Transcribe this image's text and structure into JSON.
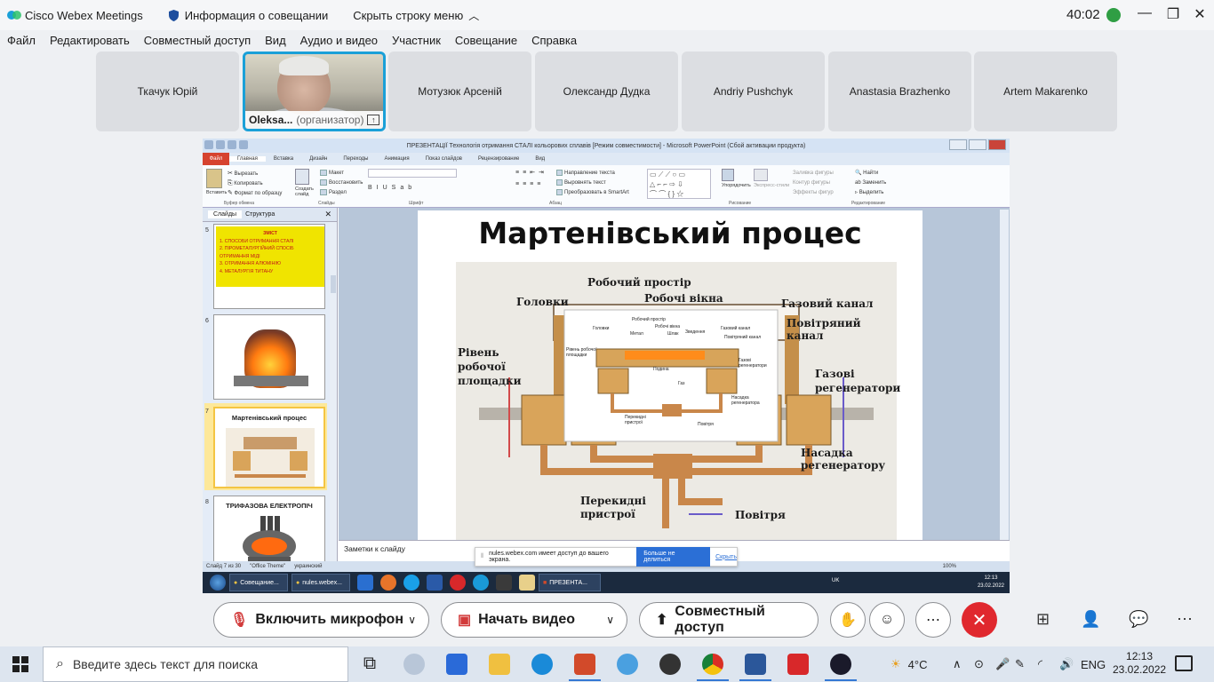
{
  "titlebar": {
    "app_name": "Cisco Webex Meetings",
    "meeting_info": "Информация о совещании",
    "hide_menu": "Скрыть строку меню",
    "elapsed": "40:02"
  },
  "menu": [
    "Файл",
    "Редактировать",
    "Совместный доступ",
    "Вид",
    "Аудио и видео",
    "Участник",
    "Совещание",
    "Справка"
  ],
  "participants": [
    {
      "name": "Ткачук Юрій"
    },
    {
      "name": "Oleksa...",
      "role": "(организатор)",
      "video": true
    },
    {
      "name": "Мотузюк Арсеній"
    },
    {
      "name": "Олександр Дудка"
    },
    {
      "name": "Andriy Pushchyk"
    },
    {
      "name": "Anastasia Brazhenko"
    },
    {
      "name": "Artem Makarenko"
    }
  ],
  "shared": {
    "window_title": "ПРЕЗЕНТАЦІЇ Технологія отримання СТАЛІ кольорових сплавів [Режим совместимости] - Microsoft PowerPoint (Сбой активации продукта)",
    "ribbon_tabs": [
      "Файл",
      "Главная",
      "Вставка",
      "Дизайн",
      "Переходы",
      "Анимация",
      "Показ слайдов",
      "Рецензирование",
      "Вид"
    ],
    "ribbon": {
      "cut": "Вырезать",
      "copy": "Копировать",
      "format_painter": "Формат по образцу",
      "paste": "Вставить",
      "new_slide": "Создать слайд",
      "layout": "Макет",
      "reset": "Восстановить",
      "section": "Раздел",
      "text_direction": "Направление текста",
      "align_text": "Выровнять текст",
      "smartart": "Преобразовать в SmartArt",
      "arrange": "Упорядочить",
      "quick_styles": "Экспресс-стили",
      "shape_fill": "Заливка фигуры",
      "shape_outline": "Контур фигуры",
      "shape_effects": "Эффекты фигур",
      "find": "Найти",
      "replace": "Заменить",
      "select": "Выделить"
    },
    "group_labels": [
      "Буфер обмена",
      "Слайды",
      "Шрифт",
      "Абзац",
      "Рисование",
      "Редактирование"
    ],
    "left_tabs": [
      "Слайды",
      "Структура"
    ],
    "thumbnails": [
      {
        "num": "5",
        "title": "ЗМІСТ",
        "lines": [
          "1. СПОСОБИ ОТРИМАННЯ СТАЛІ",
          "2. ПІРОМЕТАЛУРГІЙНИЙ СПОСІБ ОТРИМАННЯ МІДІ",
          "3. ОТРИМАННЯ АЛЮМІНІЮ",
          "4. МЕТАЛУРГІЯ ТИТАНУ"
        ]
      },
      {
        "num": "6"
      },
      {
        "num": "7",
        "title": "Мартенівський процес"
      },
      {
        "num": "8",
        "title": "ТРИФАЗОВА ЕЛЕКТРОПІЧ"
      }
    ],
    "slide": {
      "title": "Мартенівський процес",
      "labels": {
        "working_space": "Робочий простір",
        "working_windows": "Робочі вікна",
        "heads": "Головки",
        "gas_channel": "Газовий канал",
        "air_channel": "Повітряний канал",
        "platform_level": "Рівень робочої площадки",
        "gas_regenerators": "Газові регенератори",
        "regenerator_packing": "Насадка регенератору",
        "switching_devices": "Перекидні пристрої",
        "air": "Повітря"
      },
      "inset_labels": {
        "working_space": "Робочий простір",
        "heads": "Головки",
        "metal": "Метал",
        "windows": "Робочі вікна",
        "slag": "Шлак",
        "cooling": "Зведення",
        "gas_channel": "Газовий канал",
        "air_channel": "Повітряний канал",
        "platform": "Рівень робочої площадки",
        "gas_regen": "Газові регенератори",
        "hearth": "Подина",
        "gas": "Газ",
        "packing": "Насадка регенератора",
        "switching": "Перекидні пристрої",
        "air": "Повітря"
      }
    },
    "notes_placeholder": "Заметки к слайду",
    "status": {
      "slide_count": "Слайд 7 из 30",
      "theme": "\"Office Theme\"",
      "language": "украинский",
      "zoom": "100%"
    },
    "share_notice": {
      "text": "nules.webex.com имеет доступ до вашего экрана.",
      "stop_button": "Больше не делиться",
      "hide_link": "Скрыть"
    },
    "inner_taskbar": {
      "items": [
        "Совещание...",
        "nules.webex...",
        "ПРЕЗЕНТА..."
      ],
      "lang": "UK",
      "time": "12:13",
      "date": "23.02.2022"
    }
  },
  "controls": {
    "mic": "Включить микрофон",
    "video": "Начать видео",
    "share": "Совместный доступ"
  },
  "taskbar": {
    "search_placeholder": "Введите здесь текст для поиска",
    "weather": "4°C",
    "lang": "ENG",
    "time": "12:13",
    "date": "23.02.2022"
  },
  "colors": {
    "accent": "#1aa0d8",
    "end_call": "#e0282e",
    "thumb_yellow": "#f0e400",
    "thumb_red_text": "#c21818"
  }
}
